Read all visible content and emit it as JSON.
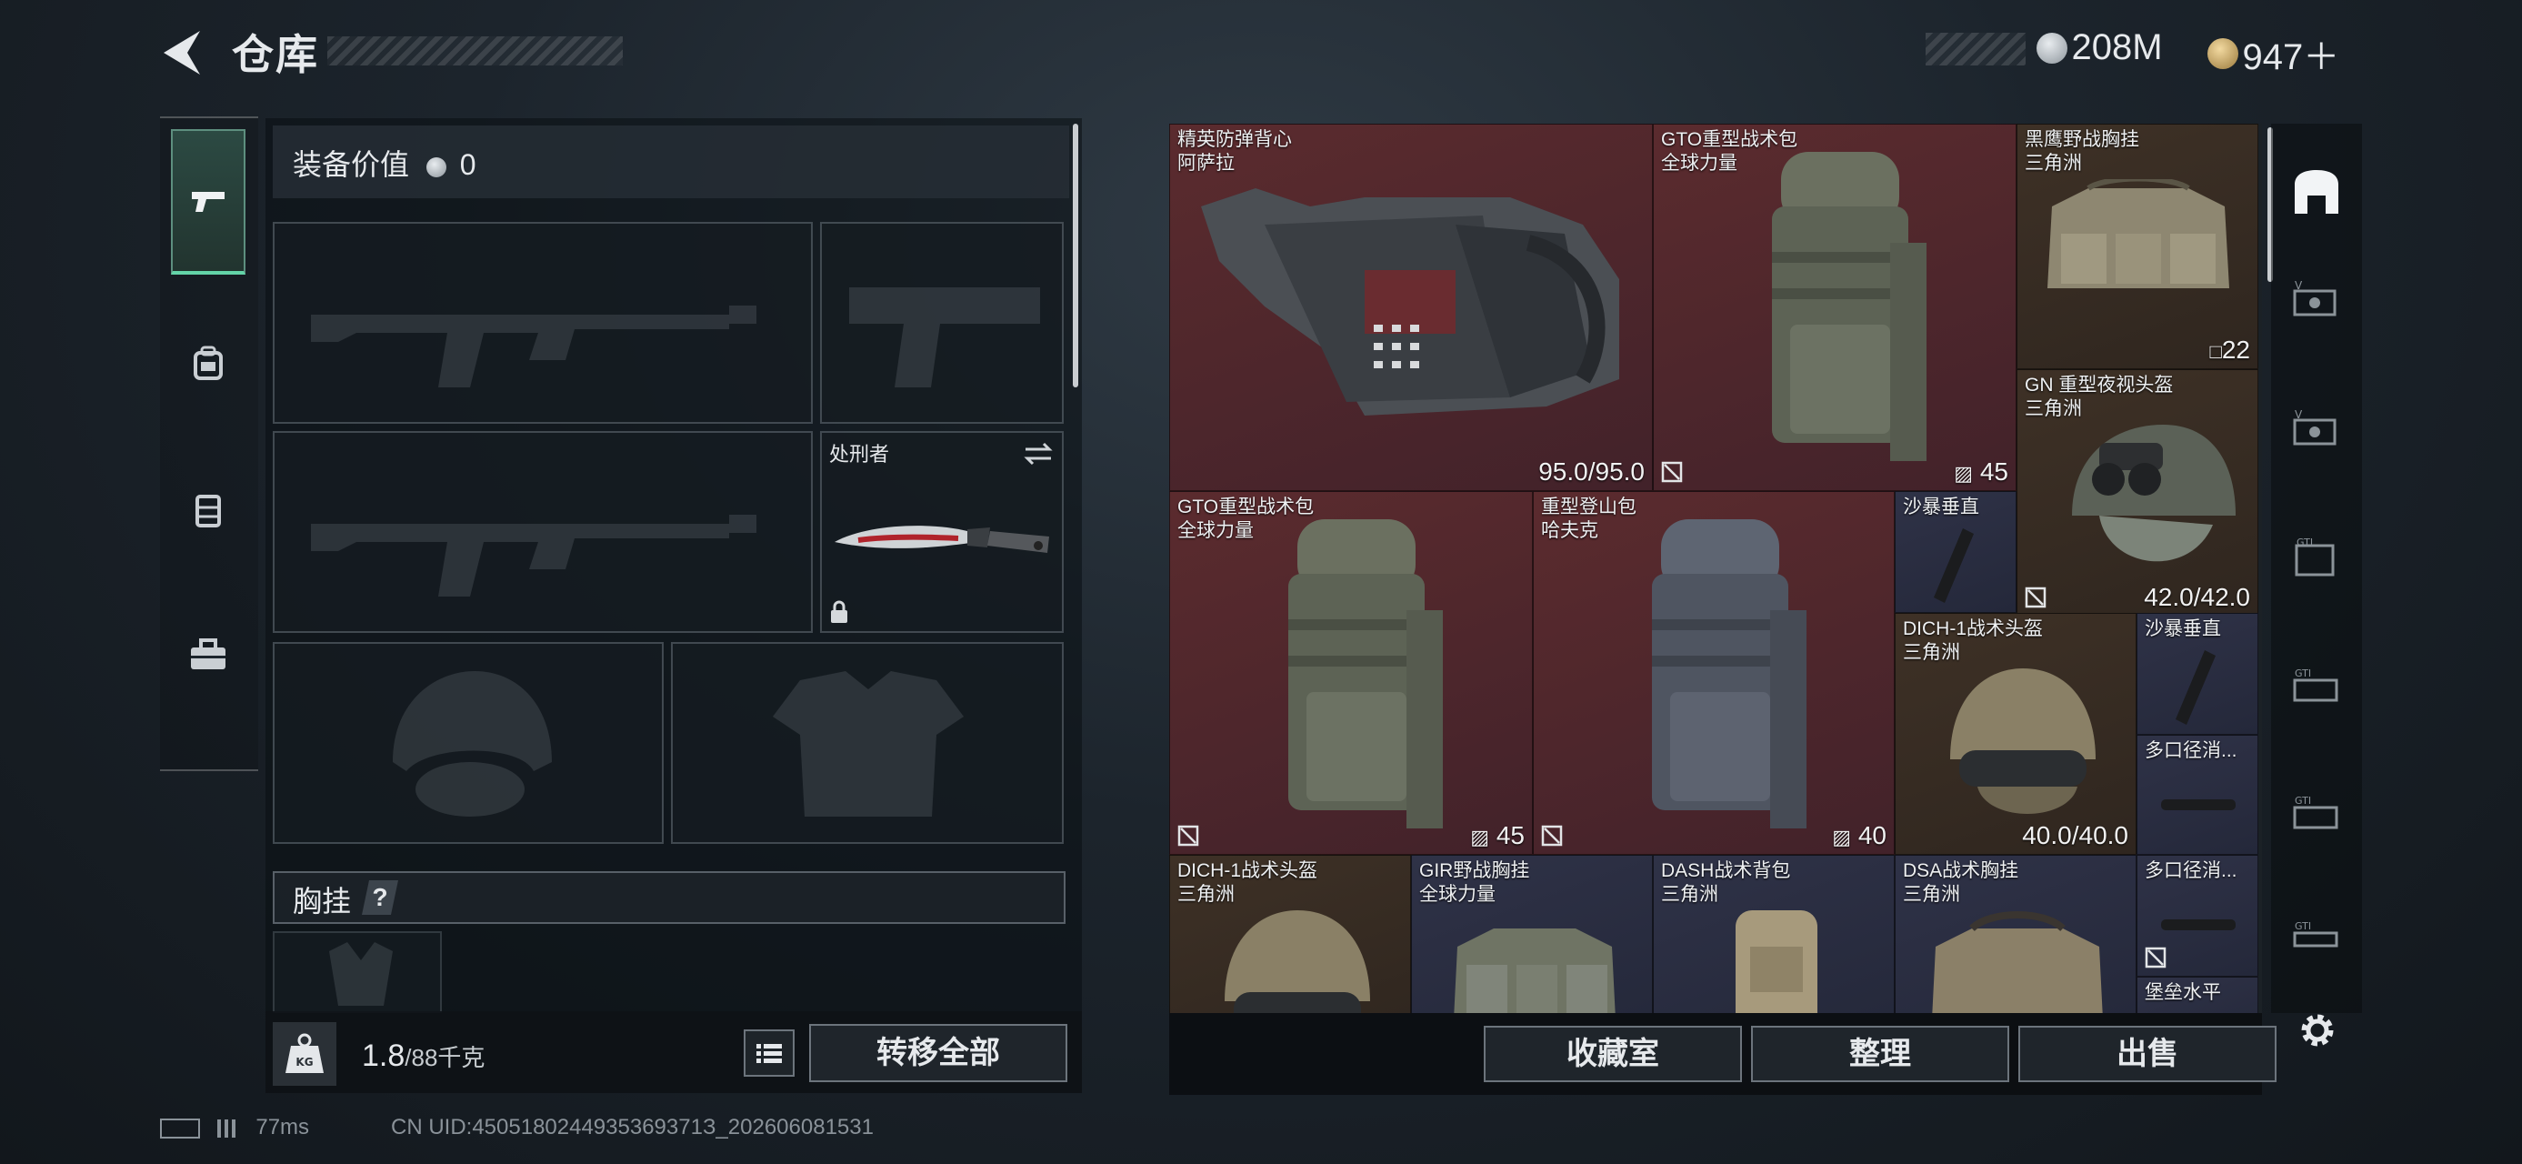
{
  "header": {
    "title": "仓库"
  },
  "currency": [
    {
      "icon": "silver-coin-icon",
      "value": "208M"
    },
    {
      "icon": "gold-triangle-coin-icon",
      "value": "947＋"
    }
  ],
  "left_nav": [
    "pistol-icon",
    "backpack-icon",
    "case-icon",
    "toolbox-icon"
  ],
  "loadout": {
    "value_label": "装备价值",
    "value": "0",
    "knife_name": "处刑者",
    "chest_label": "胸挂",
    "chest_help": "?",
    "weight_current": "1.8",
    "weight_max": "/88千克",
    "transfer_all": "转移全部"
  },
  "stash_items": [
    {
      "id": "vest",
      "name": "精英防弹背心",
      "source": "阿萨拉",
      "stat": "95.0/95.0",
      "color": "red"
    },
    {
      "id": "gto1",
      "name": "GTO重型战术包",
      "source": "全球力量",
      "stat": "45",
      "color": "red"
    },
    {
      "id": "blackhawk",
      "name": "黑鹰野战胸挂",
      "source": "三角洲",
      "stat": "22",
      "color": "brown"
    },
    {
      "id": "gn",
      "name": "GN 重型夜视头盔",
      "source": "三角洲",
      "stat": "42.0/42.0",
      "color": "brown"
    },
    {
      "id": "gto2",
      "name": "GTO重型战术包",
      "source": "全球力量",
      "stat": "45",
      "color": "red"
    },
    {
      "id": "climb",
      "name": "重型登山包",
      "source": "哈夫克",
      "stat": "40",
      "color": "red"
    },
    {
      "id": "sand1",
      "name": "沙暴垂直",
      "source": "",
      "stat": "",
      "color": "blue"
    },
    {
      "id": "dich1",
      "name": "DICH-1战术头盔",
      "source": "三角洲",
      "stat": "40.0/40.0",
      "color": "brown"
    },
    {
      "id": "sand2",
      "name": "沙暴垂直",
      "source": "",
      "stat": "",
      "color": "blue"
    },
    {
      "id": "muzzle1",
      "name": "多口径消...",
      "source": "",
      "stat": "",
      "color": "blue"
    },
    {
      "id": "dich2",
      "name": "DICH-1战术头盔",
      "source": "三角洲",
      "stat": "",
      "color": "brown"
    },
    {
      "id": "gir",
      "name": "GIR野战胸挂",
      "source": "全球力量",
      "stat": "",
      "color": "blue"
    },
    {
      "id": "dash",
      "name": "DASH战术背包",
      "source": "三角洲",
      "stat": "",
      "color": "blue"
    },
    {
      "id": "dsa",
      "name": "DSA战术胸挂",
      "source": "三角洲",
      "stat": "",
      "color": "blue"
    },
    {
      "id": "muzzle2",
      "name": "多口径消...",
      "source": "",
      "stat": "",
      "color": "blue"
    },
    {
      "id": "fort",
      "name": "堡垒水平",
      "source": "",
      "stat": "",
      "color": "blue"
    }
  ],
  "stash_actions": {
    "collection": "收藏室",
    "organize": "整理",
    "sell": "出售"
  },
  "status": {
    "ping": "77ms",
    "uid": "CN UID:4505180244935369371З_202606081531"
  },
  "colors": {
    "accent_green": "#63d4a8",
    "red_rarity": "#5b2b2e",
    "blue_rarity": "#2f3247",
    "brown_rarity": "#3e3126"
  }
}
